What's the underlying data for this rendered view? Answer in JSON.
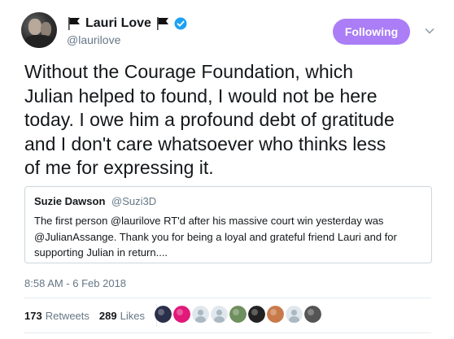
{
  "author": {
    "display_name": "Lauri Love",
    "handle": "@laurilove",
    "flag_icon": "black-flag-icon",
    "verified_icon": "verified-badge-icon",
    "verified_color": "#1da1f2"
  },
  "follow_button": {
    "label": "Following",
    "color": "#ab7df6"
  },
  "tweet": {
    "text": "Without the Courage Foundation, which\nJulian helped to found, I would not be here\ntoday. I owe him a profound debt of gratitude\nand I don't care whatsoever who thinks less\nof me for expressing it."
  },
  "quoted_tweet": {
    "name": "Suzie Dawson",
    "handle": "@Suzi3D",
    "text": "The first person @laurilove RT'd after his massive court win yesterday was\n@JulianAssange. Thank you for being a loyal and grateful friend Lauri and for\nsupporting Julian in return...."
  },
  "timestamp": "8:58 AM - 6 Feb 2018",
  "stats": {
    "retweets_count": "173",
    "retweets_label": "Retweets",
    "likes_count": "289",
    "likes_label": "Likes"
  },
  "likers": [
    {
      "icon": "liker-avatar-icon",
      "color": "#2a2f4a"
    },
    {
      "icon": "liker-avatar-icon",
      "color": "#e0197a"
    },
    {
      "icon": "default-avatar-icon",
      "color": "#aab8c2"
    },
    {
      "icon": "default-avatar-icon",
      "color": "#aab8c2"
    },
    {
      "icon": "liker-avatar-icon",
      "color": "#6e8f5e"
    },
    {
      "icon": "liker-avatar-icon",
      "color": "#222222"
    },
    {
      "icon": "liker-avatar-icon",
      "color": "#c97a4a"
    },
    {
      "icon": "default-avatar-icon",
      "color": "#aab8c2"
    },
    {
      "icon": "liker-avatar-icon",
      "color": "#555555"
    }
  ]
}
